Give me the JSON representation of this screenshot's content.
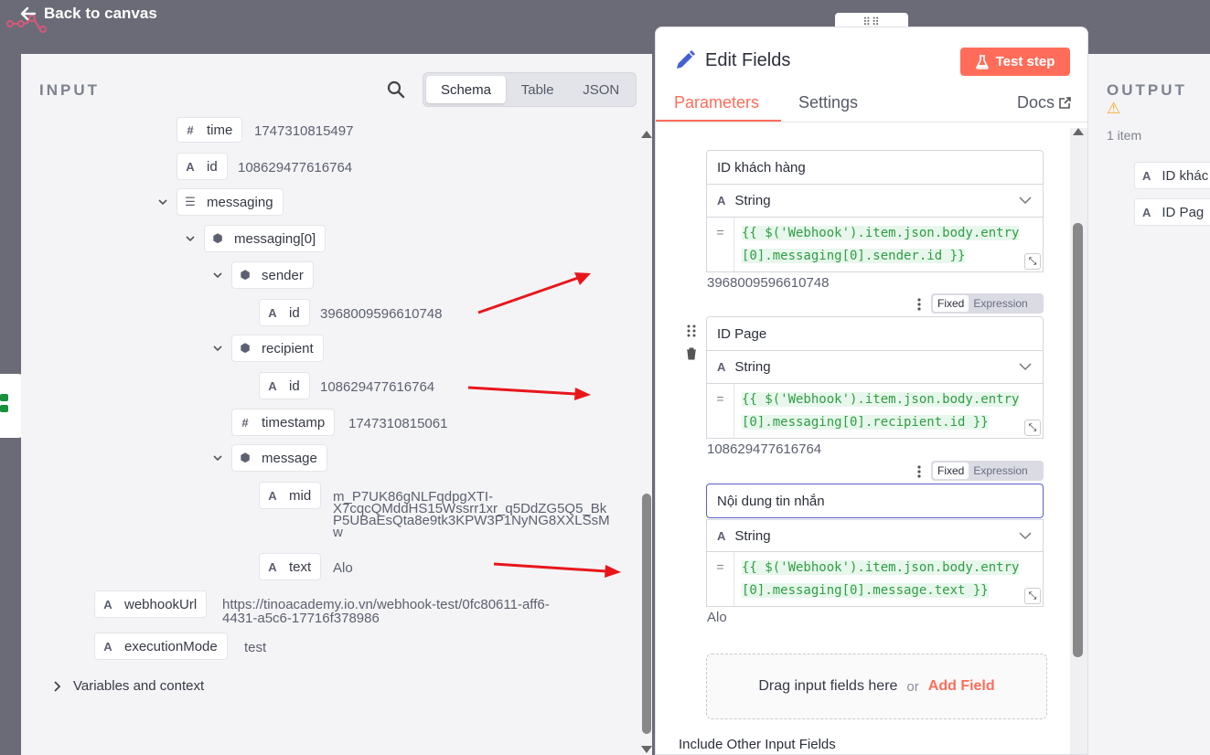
{
  "topbar": {
    "back_label": "Back to canvas"
  },
  "input": {
    "title": "INPUT",
    "views": [
      "Schema",
      "Table",
      "JSON"
    ],
    "rows": {
      "time_key": "time",
      "time_val": "1747310815497",
      "id1_key": "id",
      "id1_val": "108629477616764",
      "messaging_key": "messaging",
      "messaging0_key": "messaging[0]",
      "sender_key": "sender",
      "sender_id_key": "id",
      "sender_id_val": "3968009596610748",
      "recipient_key": "recipient",
      "recipient_id_key": "id",
      "recipient_id_val": "108629477616764",
      "timestamp_key": "timestamp",
      "timestamp_val": "1747310815061",
      "message_key": "message",
      "mid_key": "mid",
      "mid_val_1": "m_P7UK86gNLFqdpgXTI-",
      "mid_val_2": "X7cqcQMddHS15Wssrr1xr_q5DdZG5Q5_Bk",
      "mid_val_3": "P5UBaEsQta8e9tk3KPW3P1NyNG8XXLSsM",
      "mid_val_4": "w",
      "text_key": "text",
      "text_val": "Alo",
      "webhookurl_key": "webhookUrl",
      "webhookurl_val_1": "https://tinoacademy.io.vn/webhook-test/0fc80611-aff6-",
      "webhookurl_val_2": "4431-a5c6-17716f378986",
      "execmode_key": "executionMode",
      "execmode_val": "test"
    },
    "variables_label": "Variables and context"
  },
  "edit": {
    "title": "Edit Fields",
    "test_step": "Test step",
    "tabs": [
      "Parameters",
      "Settings"
    ],
    "docs": "Docs",
    "fields": [
      {
        "name": "ID khách hàng",
        "type": "String",
        "expr_1": "{{ $('Webhook').item.json.body.entry",
        "expr_2": "[0].messaging[0].sender.id }}",
        "result": "3968009596610748"
      },
      {
        "name": "ID Page",
        "type": "String",
        "expr_1": "{{ $('Webhook').item.json.body.entry",
        "expr_2": "[0].messaging[0].recipient.id }}",
        "result": "108629477616764"
      },
      {
        "name": "Nội dung tin nhắn",
        "type": "String",
        "expr_1": "{{ $('Webhook').item.json.body.entry",
        "expr_2": "[0].messaging[0].message.text }}",
        "result": "Alo"
      }
    ],
    "mode_fixed": "Fixed",
    "mode_expression": "Expression",
    "drop_text": "Drag input fields here",
    "drop_or": "or",
    "add_field": "Add Field",
    "include_other": "Include Other Input Fields"
  },
  "output": {
    "title": "OUTPUT",
    "count": "1 item",
    "fields": [
      "ID khác",
      "ID Pag"
    ]
  },
  "colors": {
    "accent": "#ff6d5a",
    "expression_green": "#2f9e44",
    "annotation_red": "#e8161b"
  }
}
